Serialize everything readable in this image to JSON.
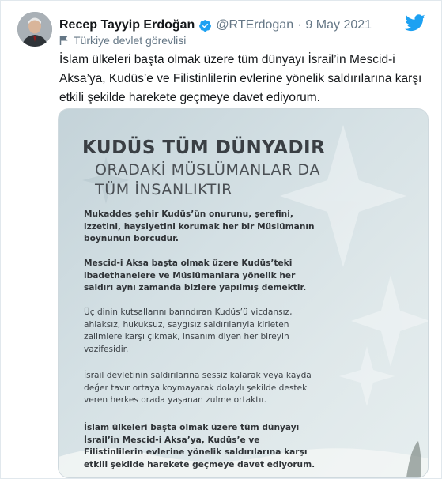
{
  "tweet": {
    "display_name": "Recep Tayyip Erdoğan",
    "handle": "@RTErdogan",
    "separator": "·",
    "date": "9 May 2021",
    "label": "Türkiye devlet görevlisi",
    "text": "İslam ülkeleri başta olmak üzere tüm dünyayı İsrail’in Mescid-i Aksa’ya, Kudüs’e ve Filistinlilerin evlerine yönelik saldırılarına karşı etkili şekilde harekete geçmeye davet ediyorum."
  },
  "icons": {
    "verified": "verified-badge-icon",
    "label": "flag-icon",
    "brand": "twitter-bird-icon"
  },
  "colors": {
    "twitter_blue": "#1da1f2",
    "text": "#14171a",
    "muted": "#657786"
  },
  "poster": {
    "title": "KUDÜS TÜM DÜNYADIR",
    "subtitle_line1": "ORADAKİ MÜSLÜMANLAR DA",
    "subtitle_line2": "TÜM İNSANLIKTIR",
    "paragraphs": [
      "Mukaddes şehir Kudüs’ün onurunu, şerefini, izzetini, haysiyetini korumak her bir Müslümanın boynunun borcudur.",
      "Mescid-i Aksa başta olmak üzere Kudüs’teki ibadethanelere ve Müslümanlara yönelik her saldırı aynı zamanda bizlere yapılmış demektir.",
      "Üç dinin kutsallarını barındıran Kudüs’ü vicdansız, ahlaksız, hukuksuz, saygısız saldırılarıyla kirleten zalimlere karşı çıkmak, insanım diyen her bireyin vazifesidir.",
      "İsrail devletinin saldırılarına sessiz kalarak veya kayda değer tavır ortaya koymayarak dolaylı şekilde destek veren herkes orada yaşanan zulme ortaktır.",
      "İslam ülkeleri başta olmak üzere tüm dünyayı İsrail’in Mescid-i Aksa’ya, Kudüs’e ve Filistinlilerin evlerine yönelik saldırılarına karşı etkili şekilde harekete geçmeye davet ediyorum."
    ]
  }
}
